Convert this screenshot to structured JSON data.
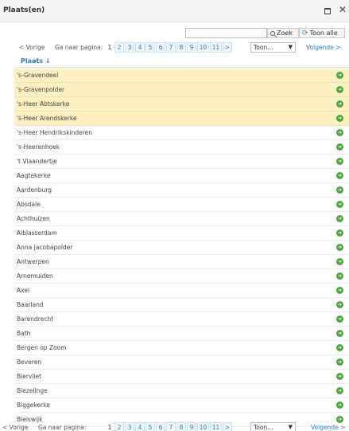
{
  "window": {
    "title": "Plaats(en)"
  },
  "search": {
    "value": "",
    "zoek_label": "Zoek",
    "toon_alle_label": "Toon alle"
  },
  "pager": {
    "prev": "< Vorige",
    "goto_label": "Ga naar pagina:",
    "current": "1",
    "pages": [
      "2",
      "3",
      "4",
      "5",
      "6",
      "7",
      "8",
      "9",
      "10",
      "11",
      ">"
    ],
    "show_select": "Toon...",
    "next": "Volgende >"
  },
  "table": {
    "column": "Plaats ↓",
    "rows": [
      {
        "name": "'s-Gravendeel",
        "selected": true
      },
      {
        "name": "'s-Gravenpolder",
        "selected": true
      },
      {
        "name": "'s-Heer Abtskerke",
        "selected": true
      },
      {
        "name": "'s-Heer Arendskerke",
        "selected": true
      },
      {
        "name": "'s-Heer Hendrikskinderen",
        "selected": false
      },
      {
        "name": "'s-Heerenhoek",
        "selected": false
      },
      {
        "name": "'t Vlaandertje",
        "selected": false
      },
      {
        "name": "Aagtekerke",
        "selected": false
      },
      {
        "name": "Aardenburg",
        "selected": false
      },
      {
        "name": "Absdale",
        "selected": false
      },
      {
        "name": "Achthuizen",
        "selected": false
      },
      {
        "name": "Alblasserdam",
        "selected": false
      },
      {
        "name": "Anna Jacobapolder",
        "selected": false
      },
      {
        "name": "Antwerpen",
        "selected": false
      },
      {
        "name": "Arnemuiden",
        "selected": false
      },
      {
        "name": "Axel",
        "selected": false
      },
      {
        "name": "Baarland",
        "selected": false
      },
      {
        "name": "Barendrecht",
        "selected": false
      },
      {
        "name": "Bath",
        "selected": false
      },
      {
        "name": "Bergen op Zoom",
        "selected": false
      },
      {
        "name": "Beveren",
        "selected": false
      },
      {
        "name": "Biervliet",
        "selected": false
      },
      {
        "name": "Biezelinge",
        "selected": false
      },
      {
        "name": "Biggekerke",
        "selected": false
      },
      {
        "name": "Bleiswijk",
        "selected": false
      }
    ]
  },
  "colors": {
    "link": "#2a7fc0",
    "selected_row": "#fdf0c2",
    "go_icon": "#4caa3c"
  }
}
